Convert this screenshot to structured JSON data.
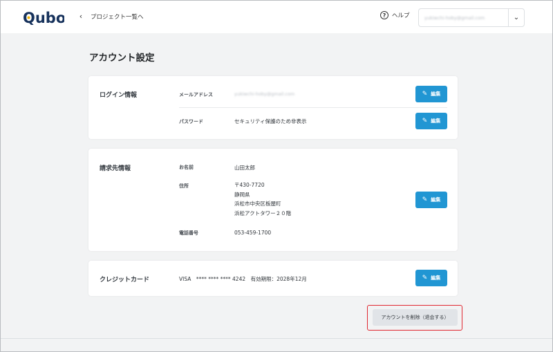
{
  "header": {
    "logo_text": "Qubo",
    "back_label": "プロジェクト一覧へ",
    "help_label": "ヘルプ",
    "account_email": "yukiwchi-hoby@gmail.com"
  },
  "page_title": "アカウント設定",
  "login": {
    "title": "ログイン情報",
    "email_label": "メールアドレス",
    "email_value": "yukiwchi-hoby@gmail.com",
    "password_label": "パスワード",
    "password_value": "セキュリティ保護のため非表示",
    "edit_label": "編集"
  },
  "billing": {
    "title": "請求先情報",
    "name_label": "お名前",
    "name_value": "山田太郎",
    "address_label": "住所",
    "address_lines": [
      "〒430-7720",
      "静岡県",
      "浜松市中央区板屋町",
      "浜松アクトタワー２０階"
    ],
    "phone_label": "電話番号",
    "phone_value": "053-459-1700",
    "edit_label": "編集"
  },
  "card": {
    "title": "クレジットカード",
    "value": "VISA　**** **** **** 4242　有効期限：2028年12月",
    "edit_label": "編集"
  },
  "delete_label": "アカウントを削除（退会する）",
  "colors": {
    "accent": "#2196d3",
    "highlight": "#e0262f"
  }
}
